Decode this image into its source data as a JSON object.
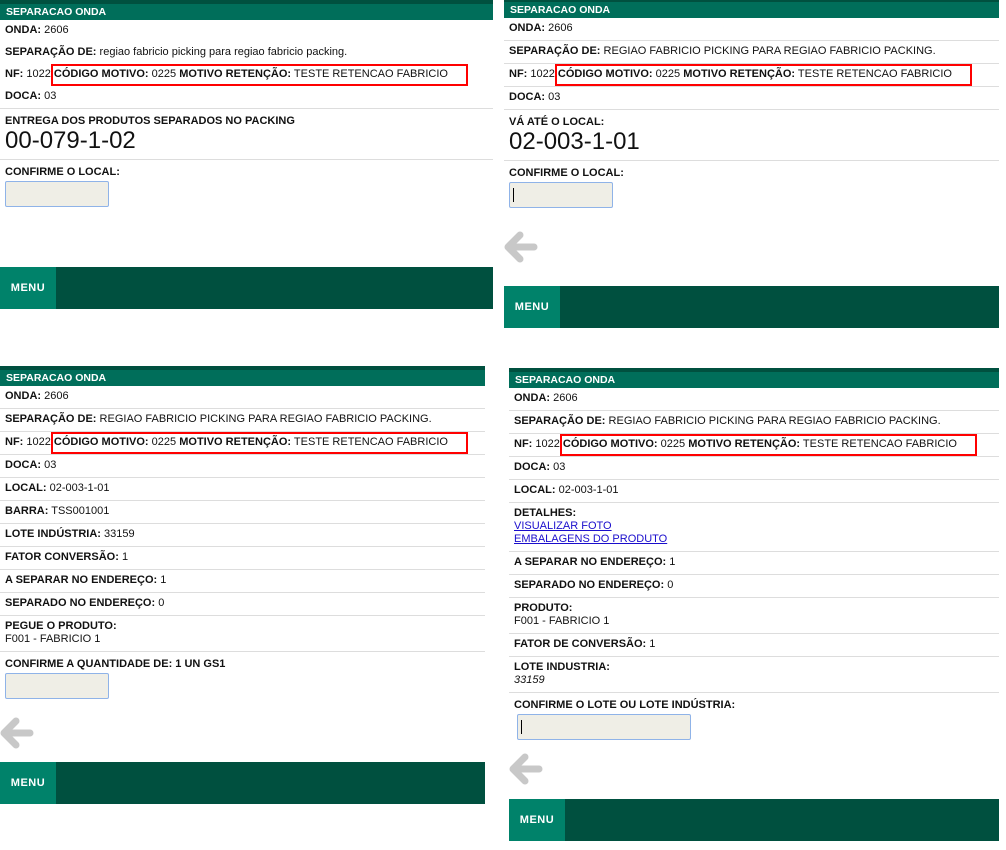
{
  "panels": [
    {
      "header": "SEPARACAO ONDA",
      "rows": [
        {
          "type": "kv",
          "label": "ONDA:",
          "value": "2606"
        },
        {
          "type": "kv",
          "label": "SEPARAÇÃO DE:",
          "value": "regiao fabricio picking para regiao fabricio packing."
        },
        {
          "type": "nf",
          "label": "NF:",
          "value": "1022",
          "code_label": "CÓDIGO MOTIVO:",
          "code": "0225",
          "reason_label": "MOTIVO RETENÇÃO:",
          "reason": "TESTE RETENCAO FABRICIO"
        },
        {
          "type": "kv",
          "label": "DOCA:",
          "value": "03"
        },
        {
          "type": "big",
          "label": "ENTREGA DOS PRODUTOS SEPARADOS NO PACKING",
          "value": "00-079-1-02"
        },
        {
          "type": "input",
          "label": "CONFIRME O LOCAL:",
          "value": ""
        }
      ],
      "menu": "MENU"
    },
    {
      "header": "SEPARACAO ONDA",
      "rows": [
        {
          "type": "kv",
          "label": "ONDA:",
          "value": "2606"
        },
        {
          "type": "kv",
          "label": "SEPARAÇÃO DE:",
          "value": "REGIAO FABRICIO PICKING PARA REGIAO FABRICIO PACKING."
        },
        {
          "type": "nf",
          "label": "NF:",
          "value": "1022",
          "code_label": "CÓDIGO MOTIVO:",
          "code": "0225",
          "reason_label": "MOTIVO RETENÇÃO:",
          "reason": "TESTE RETENCAO FABRICIO"
        },
        {
          "type": "kv",
          "label": "DOCA:",
          "value": "03"
        },
        {
          "type": "big",
          "label": "VÁ ATÉ O LOCAL:",
          "value": "02-003-1-01"
        },
        {
          "type": "input",
          "label": "CONFIRME O LOCAL:",
          "value": "",
          "caret": true
        }
      ],
      "menu": "MENU"
    },
    {
      "header": "SEPARACAO ONDA",
      "rows": [
        {
          "type": "kv",
          "label": "ONDA:",
          "value": "2606"
        },
        {
          "type": "kv",
          "label": "SEPARAÇÃO DE:",
          "value": "REGIAO FABRICIO PICKING PARA REGIAO FABRICIO PACKING."
        },
        {
          "type": "nf",
          "label": "NF:",
          "value": "1022",
          "code_label": "CÓDIGO MOTIVO:",
          "code": "0225",
          "reason_label": "MOTIVO RETENÇÃO:",
          "reason": "TESTE RETENCAO FABRICIO"
        },
        {
          "type": "kv",
          "label": "DOCA:",
          "value": "03"
        },
        {
          "type": "kv",
          "label": "LOCAL:",
          "value": "02-003-1-01"
        },
        {
          "type": "kv",
          "label": "BARRA:",
          "value": "TSS001001"
        },
        {
          "type": "kv",
          "label": "LOTE INDÚSTRIA:",
          "value": "33159"
        },
        {
          "type": "kv",
          "label": "FATOR CONVERSÃO:",
          "value": "1"
        },
        {
          "type": "kv",
          "label": "A SEPARAR NO ENDEREÇO:",
          "value": "1"
        },
        {
          "type": "kv",
          "label": "SEPARADO NO ENDEREÇO:",
          "value": "0"
        },
        {
          "type": "stack",
          "label": "PEGUE O PRODUTO:",
          "value": "F001 - FABRICIO 1"
        },
        {
          "type": "input",
          "label": "CONFIRME A QUANTIDADE DE: 1 UN GS1",
          "value": ""
        }
      ],
      "menu": "MENU"
    },
    {
      "header": "SEPARACAO ONDA",
      "rows": [
        {
          "type": "kv",
          "label": "ONDA:",
          "value": "2606"
        },
        {
          "type": "kv",
          "label": "SEPARAÇÃO DE:",
          "value": "REGIAO FABRICIO PICKING PARA REGIAO FABRICIO PACKING."
        },
        {
          "type": "nf",
          "label": "NF:",
          "value": "1022",
          "code_label": "CÓDIGO MOTIVO:",
          "code": "0225",
          "reason_label": "MOTIVO RETENÇÃO:",
          "reason": "TESTE RETENCAO FABRICIO"
        },
        {
          "type": "kv",
          "label": "DOCA:",
          "value": "03"
        },
        {
          "type": "kv",
          "label": "LOCAL:",
          "value": "02-003-1-01"
        },
        {
          "type": "links",
          "label": "DETALHES:",
          "links": [
            "VISUALIZAR FOTO",
            "EMBALAGENS DO PRODUTO"
          ]
        },
        {
          "type": "kv",
          "label": "A SEPARAR NO ENDEREÇO:",
          "value": "1"
        },
        {
          "type": "kv",
          "label": "SEPARADO NO ENDEREÇO:",
          "value": "0"
        },
        {
          "type": "stack",
          "label": "PRODUTO:",
          "value": "F001 - FABRICIO 1"
        },
        {
          "type": "kv",
          "label": "FATOR DE CONVERSÃO:",
          "value": "1"
        },
        {
          "type": "stack",
          "label": "LOTE INDUSTRIA:",
          "value": "33159",
          "italic": true
        },
        {
          "type": "input",
          "label": "CONFIRME O LOTE OU LOTE INDÚSTRIA:",
          "value": "",
          "caret": true,
          "wide": true
        }
      ],
      "menu": "MENU"
    }
  ],
  "colors": {
    "header": "#006e5a",
    "menu_bar": "#00503f",
    "menu_button": "#00826a",
    "highlight": "#ff0000"
  }
}
